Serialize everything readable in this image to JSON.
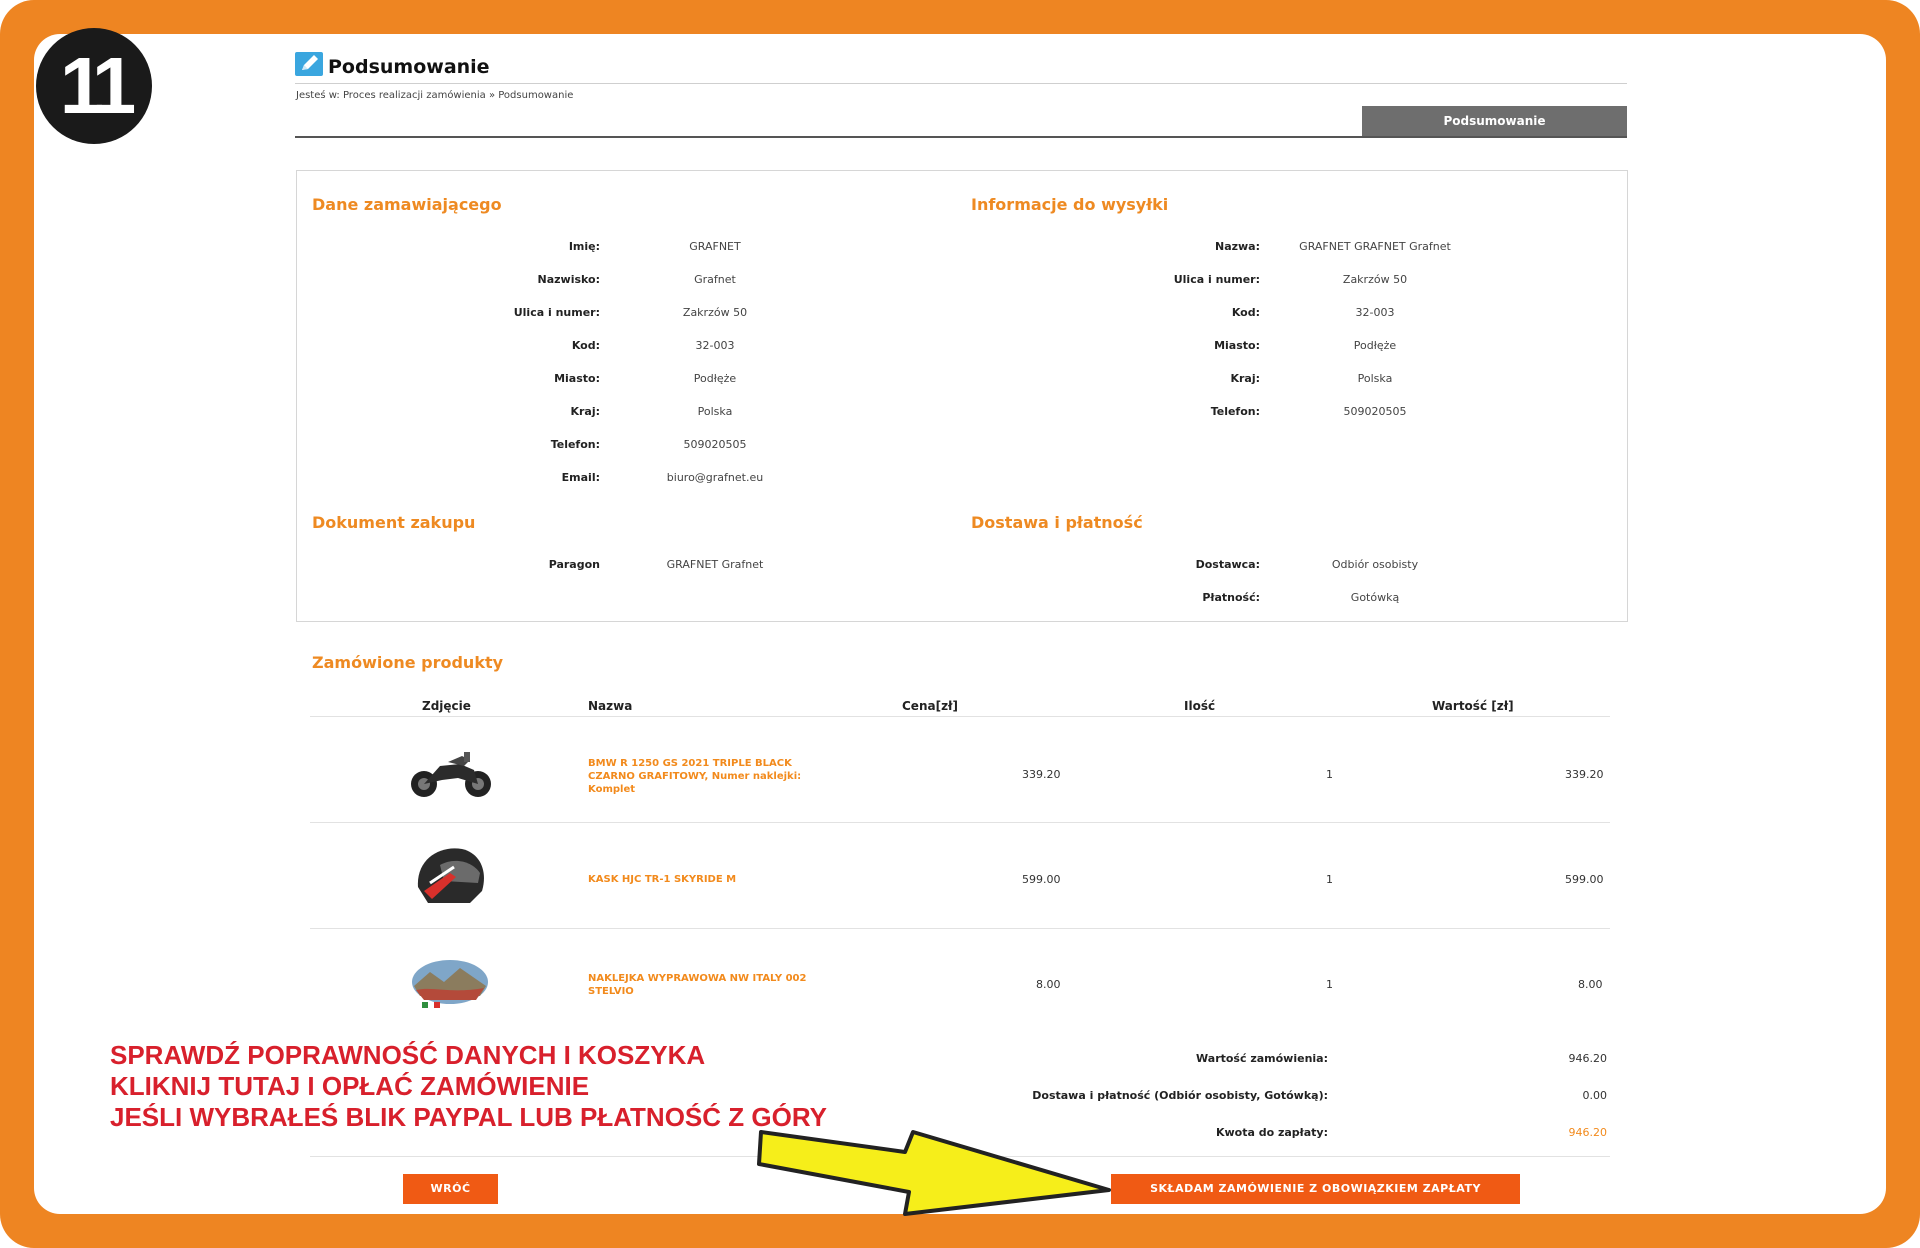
{
  "step_number": "11",
  "header": {
    "title": "Podsumowanie",
    "breadcrumb": "Jesteś w: Proces realizacji zamówienia » Podsumowanie",
    "tab_label": "Podsumowanie"
  },
  "buyer": {
    "title": "Dane zamawiającego",
    "fields": [
      {
        "label": "Imię:",
        "value": "GRAFNET"
      },
      {
        "label": "Nazwisko:",
        "value": "Grafnet"
      },
      {
        "label": "Ulica i numer:",
        "value": "Zakrzów 50"
      },
      {
        "label": "Kod:",
        "value": "32-003"
      },
      {
        "label": "Miasto:",
        "value": "Podłęże"
      },
      {
        "label": "Kraj:",
        "value": "Polska"
      },
      {
        "label": "Telefon:",
        "value": "509020505"
      },
      {
        "label": "Email:",
        "value": "biuro@grafnet.eu"
      }
    ]
  },
  "shipping": {
    "title": "Informacje do wysyłki",
    "fields": [
      {
        "label": "Nazwa:",
        "value": "GRAFNET GRAFNET Grafnet"
      },
      {
        "label": "Ulica i numer:",
        "value": "Zakrzów 50"
      },
      {
        "label": "Kod:",
        "value": "32-003"
      },
      {
        "label": "Miasto:",
        "value": "Podłęże"
      },
      {
        "label": "Kraj:",
        "value": "Polska"
      },
      {
        "label": "Telefon:",
        "value": "509020505"
      }
    ]
  },
  "document": {
    "title": "Dokument zakupu",
    "fields": [
      {
        "label": "Paragon",
        "value": "GRAFNET Grafnet"
      }
    ]
  },
  "delivery": {
    "title": "Dostawa i płatność",
    "fields": [
      {
        "label": "Dostawca:",
        "value": "Odbiór osobisty"
      },
      {
        "label": "Płatność:",
        "value": "Gotówką"
      }
    ]
  },
  "products": {
    "title": "Zamówione produkty",
    "columns": [
      "Zdjęcie",
      "Nazwa",
      "Cena[zł]",
      "Ilość",
      "Wartość [zł]"
    ],
    "rows": [
      {
        "image": "motorcycle-image",
        "name": "BMW R 1250 GS 2021 TRIPLE BLACK CZARNO GRAFITOWY, Numer naklejki: Komplet",
        "price": "339.20",
        "qty": "1",
        "value": "339.20"
      },
      {
        "image": "helmet-image",
        "name": "KASK HJC TR-1 SKYRIDE M",
        "price": "599.00",
        "qty": "1",
        "value": "599.00"
      },
      {
        "image": "sticker-image",
        "name": "NAKLEJKA WYPRAWOWA NW ITALY 002 STELVIO",
        "price": "8.00",
        "qty": "1",
        "value": "8.00"
      }
    ]
  },
  "totals": {
    "order_value_label": "Wartość zamówienia:",
    "order_value": "946.20",
    "delivery_label": "Dostawa i płatność (Odbiór osobisty, Gotówką):",
    "delivery_value": "0.00",
    "to_pay_label": "Kwota do zapłaty:",
    "to_pay_value": "946.20"
  },
  "buttons": {
    "back": "WRÓĆ",
    "submit": "SKŁADAM ZAMÓWIENIE Z OBOWIĄZKIEM ZAPŁATY"
  },
  "instructions": {
    "line1": "SPRAWDŹ POPRAWNOŚĆ DANYCH I KOSZYKA",
    "line2": "KLIKNIJ TUTAJ I OPŁAĆ ZAMÓWIENIE",
    "line3": "JEŚLI WYBRAŁEŚ BLIK PAYPAL LUB PŁATNOŚĆ Z GÓRY"
  },
  "colors": {
    "frame": "#ee8522",
    "accent": "#f28a1c",
    "button": "#f05a14",
    "instructions": "#d8202c",
    "arrow": "#f6ee1a"
  }
}
